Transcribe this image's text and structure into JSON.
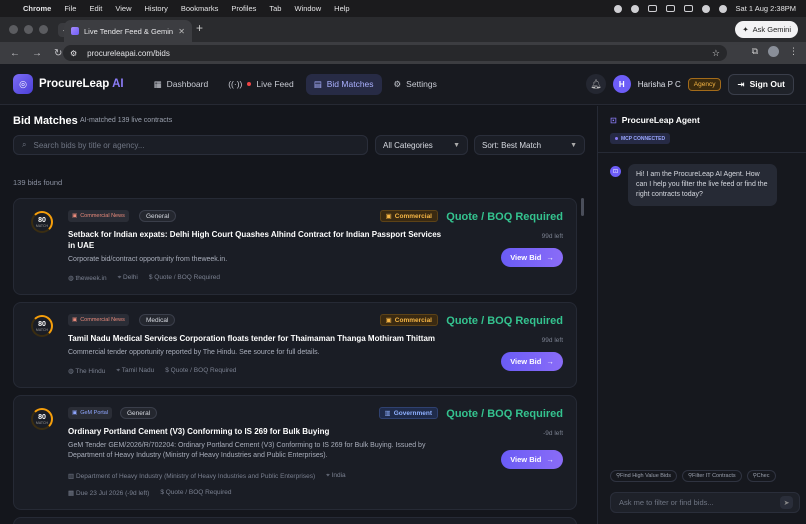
{
  "menubar": {
    "items": [
      "Chrome",
      "File",
      "Edit",
      "View",
      "History",
      "Bookmarks",
      "Profiles",
      "Tab",
      "Window",
      "Help"
    ],
    "clock": "Sat 1 Aug  2:38PM"
  },
  "browser": {
    "tab_title": "Live Tender Feed & Gemini",
    "ask_label": "Ask Gemini",
    "url": "procureleapai.com/bids"
  },
  "app": {
    "logo_name": "ProcureLeap",
    "logo_suffix": "AI",
    "nav": [
      {
        "label": "Dashboard",
        "icon": "grid-icon"
      },
      {
        "label": "Live Feed",
        "icon": "broadcast-icon"
      },
      {
        "label": "Bid Matches",
        "icon": "document-icon"
      },
      {
        "label": "Settings",
        "icon": "gear-icon"
      }
    ],
    "active_nav": "Bid Matches",
    "user_initial": "H",
    "user_name": "Harisha P C",
    "user_badge": "Agency",
    "sign_out": "Sign Out"
  },
  "main": {
    "title": "Bid Matches",
    "subtitle": "AI-matched 139 live contracts",
    "search_placeholder": "Search bids by title or agency...",
    "category_select": "All Categories",
    "sort_select": "Sort: Best Match",
    "count": "139 bids found",
    "cards": [
      {
        "score": "80",
        "score_label": "MATCH",
        "source": "Commercial News",
        "category": "General",
        "type": "Commercial",
        "requirement": "Quote / BOQ Required",
        "days_left": "99d left",
        "title": "Setback for Indian expats: Delhi High Court Quashes Alhind Contract for Indian Passport Services in UAE",
        "description": "Corporate bid/contract opportunity from theweek.in.",
        "meta": [
          "theweek.in",
          "Delhi",
          "Quote / BOQ Required"
        ],
        "action": "View Bid"
      },
      {
        "score": "80",
        "score_label": "MATCH",
        "source": "Commercial News",
        "category": "Medical",
        "type": "Commercial",
        "requirement": "Quote / BOQ Required",
        "days_left": "99d left",
        "title": "Tamil Nadu Medical Services Corporation floats tender for Thaimaman Thanga Mothiram Thittam",
        "description": "Commercial tender opportunity reported by The Hindu. See source for full details.",
        "meta": [
          "The Hindu",
          "Tamil Nadu",
          "Quote / BOQ Required"
        ],
        "action": "View Bid"
      },
      {
        "score": "80",
        "score_label": "MATCH",
        "source": "GeM Portal",
        "category": "General",
        "type": "Government",
        "requirement": "Quote / BOQ Required",
        "days_left": "-9d left",
        "title": "Ordinary Portland Cement (V3) Conforming to IS 269 for Bulk Buying",
        "description": "GeM Tender GEM/2026/R/702204: Ordinary Portland Cement (V3) Conforming to IS 269 for Bulk Buying. Issued by Department of Heavy Industry (Ministry of Heavy Industries and Public Enterprises).",
        "meta": [
          "Department of Heavy Industry (Ministry of Heavy Industries and Public Enterprises)",
          "India"
        ],
        "meta2": [
          "Due 23 Jul 2026 (-9d left)",
          "Quote / BOQ Required"
        ],
        "action": "View Bid"
      }
    ]
  },
  "agent": {
    "title": "ProcureLeap Agent",
    "status": "MCP CONNECTED",
    "greeting": "Hi! I am the ProcureLeap AI Agent. How can I help you filter the live feed or find the right contracts today?",
    "chips": [
      "Find High Value Bids",
      "Filter IT Contracts",
      "Chec"
    ],
    "input_placeholder": "Ask me to filter or find bids..."
  },
  "colors": {
    "accent": "#6d5df7",
    "success": "#34c38f",
    "warning": "#f5b544"
  }
}
